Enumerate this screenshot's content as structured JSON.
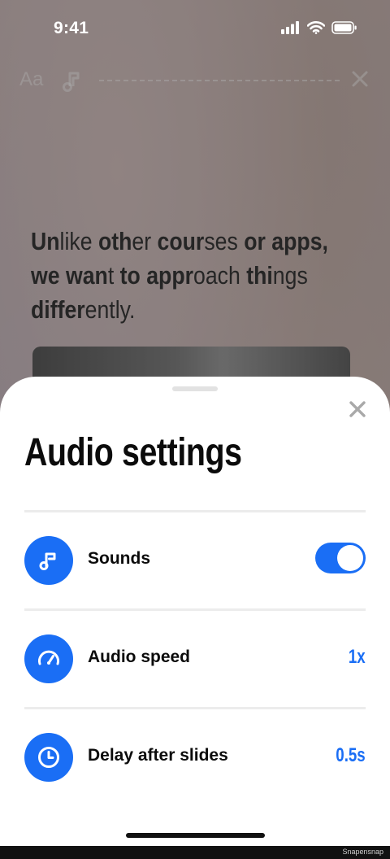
{
  "status_bar": {
    "time": "9:41"
  },
  "story": {
    "text_icon": "Aa",
    "text_parts": [
      {
        "t": "Un",
        "b": true
      },
      {
        "t": "like ",
        "b": false
      },
      {
        "t": "oth",
        "b": true
      },
      {
        "t": "er ",
        "b": false
      },
      {
        "t": "cour",
        "b": true
      },
      {
        "t": "ses ",
        "b": false
      },
      {
        "t": "or ",
        "b": true
      },
      {
        "t": "apps,",
        "b": true
      },
      {
        "br": true
      },
      {
        "t": "we ",
        "b": true
      },
      {
        "t": "wan",
        "b": true
      },
      {
        "t": "t ",
        "b": false
      },
      {
        "t": "to ",
        "b": true
      },
      {
        "t": "appr",
        "b": true
      },
      {
        "t": "oach ",
        "b": false
      },
      {
        "t": "thi",
        "b": true
      },
      {
        "t": "ngs",
        "b": false
      },
      {
        "br": true
      },
      {
        "t": "differ",
        "b": true
      },
      {
        "t": "ently.",
        "b": false
      }
    ]
  },
  "sheet": {
    "title": "Audio settings",
    "rows": [
      {
        "label": "Sounds",
        "icon": "music-note-icon",
        "toggle_on": true
      },
      {
        "label": "Audio speed",
        "icon": "speedometer-icon",
        "value": "1x"
      },
      {
        "label": "Delay after slides",
        "icon": "clock-icon",
        "value": "0.5s"
      }
    ]
  },
  "colors": {
    "accent": "#1a6ef5",
    "sheet_bg": "#ffffff",
    "divider": "#ececec"
  },
  "watermark": "Snapensnap"
}
